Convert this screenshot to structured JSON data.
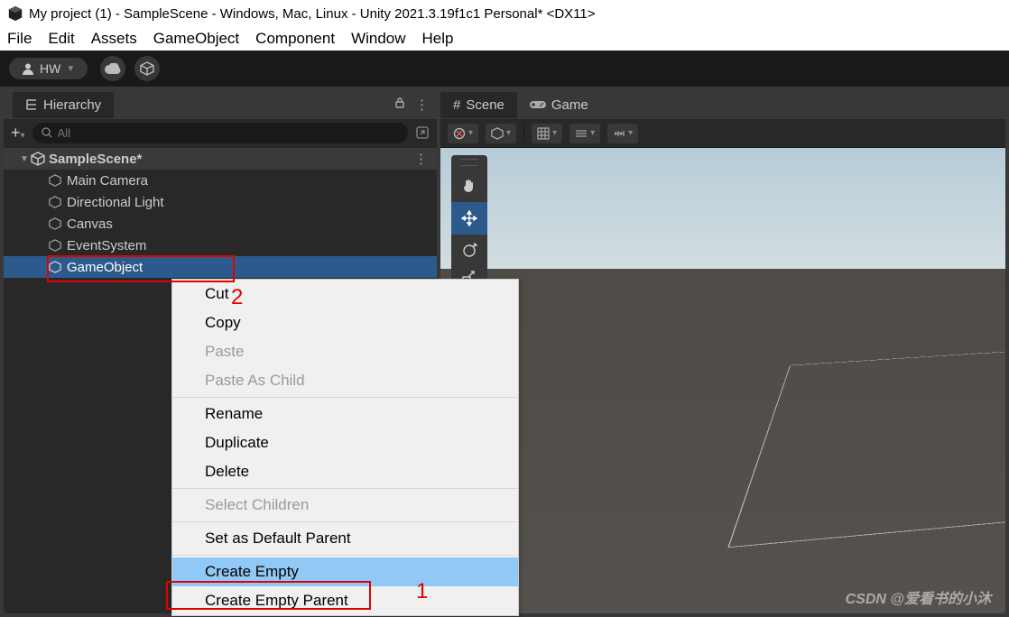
{
  "title": "My project (1) - SampleScene - Windows, Mac, Linux - Unity 2021.3.19f1c1 Personal* <DX11>",
  "menubar": [
    "File",
    "Edit",
    "Assets",
    "GameObject",
    "Component",
    "Window",
    "Help"
  ],
  "user_label": "HW",
  "hierarchy": {
    "title": "Hierarchy",
    "search": "All",
    "scene": "SampleScene*",
    "items": [
      "Main Camera",
      "Directional Light",
      "Canvas",
      "EventSystem",
      "GameObject"
    ]
  },
  "scene": {
    "tabs": [
      "Scene",
      "Game"
    ]
  },
  "context_menu": {
    "items": [
      {
        "label": "Cut",
        "kind": "item"
      },
      {
        "label": "Copy",
        "kind": "item"
      },
      {
        "label": "Paste",
        "kind": "disabled"
      },
      {
        "label": "Paste As Child",
        "kind": "disabled"
      },
      {
        "kind": "sep"
      },
      {
        "label": "Rename",
        "kind": "item"
      },
      {
        "label": "Duplicate",
        "kind": "item"
      },
      {
        "label": "Delete",
        "kind": "item"
      },
      {
        "kind": "sep"
      },
      {
        "label": "Select Children",
        "kind": "disabled"
      },
      {
        "kind": "sep"
      },
      {
        "label": "Set as Default Parent",
        "kind": "item"
      },
      {
        "kind": "sep"
      },
      {
        "label": "Create Empty",
        "kind": "hl"
      },
      {
        "label": "Create Empty Parent",
        "kind": "item"
      }
    ]
  },
  "annotations": {
    "num1": "1",
    "num2": "2"
  },
  "watermark": "CSDN @爱看书的小沐"
}
